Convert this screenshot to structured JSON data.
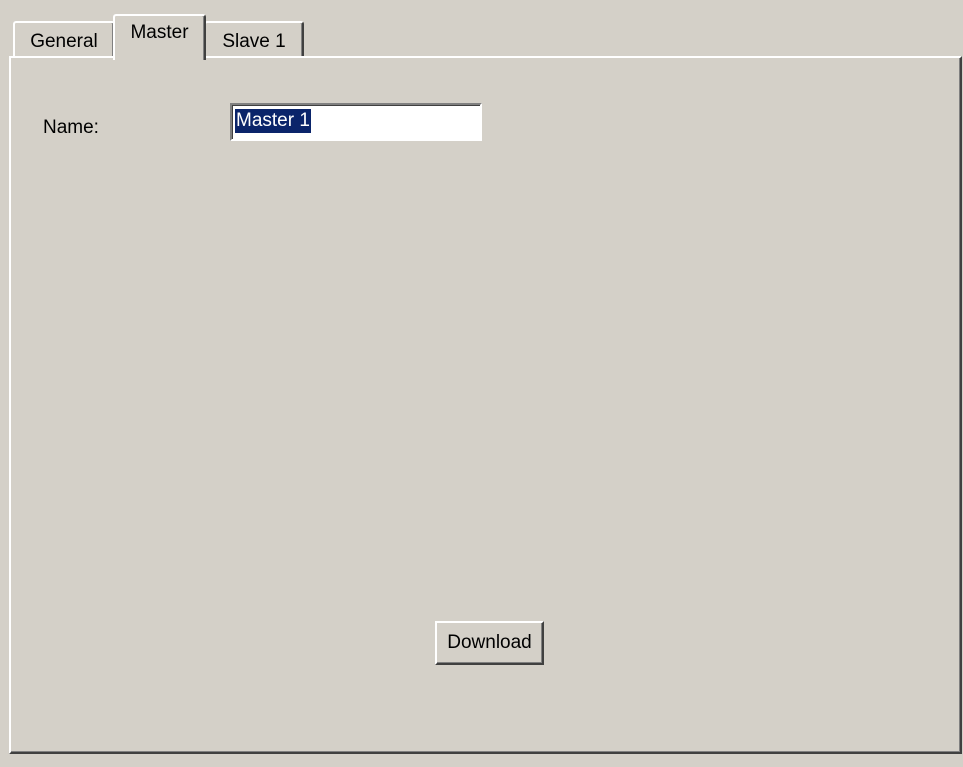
{
  "tabs": [
    {
      "label": "General",
      "selected": false
    },
    {
      "label": "Master",
      "selected": true
    },
    {
      "label": "Slave 1",
      "selected": false
    }
  ],
  "master_page": {
    "name_label": "Name:",
    "name_value": "Master 1",
    "download_label": "Download"
  },
  "colors": {
    "face": "#d4d0c8",
    "highlight": "#ffffff",
    "shadow": "#808080",
    "dark_shadow": "#404040",
    "selection": "#0a246a"
  }
}
